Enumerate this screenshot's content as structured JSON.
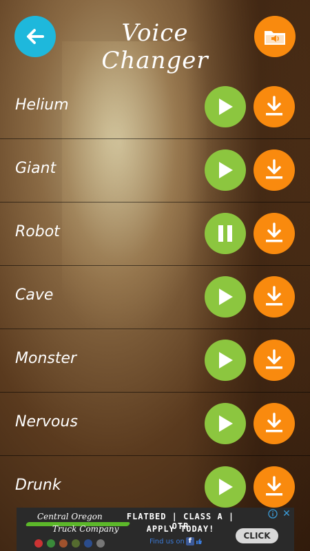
{
  "header": {
    "back_icon": "arrow-left-icon",
    "title": "Voice Changer",
    "folder_icon": "folder-sound-icon"
  },
  "effects": [
    {
      "label": "Helium",
      "state": "play"
    },
    {
      "label": "Giant",
      "state": "play"
    },
    {
      "label": "Robot",
      "state": "pause"
    },
    {
      "label": "Cave",
      "state": "play"
    },
    {
      "label": "Monster",
      "state": "play"
    },
    {
      "label": "Nervous",
      "state": "play"
    },
    {
      "label": "Drunk",
      "state": "play"
    }
  ],
  "ad": {
    "company_line1": "Central Oregon",
    "company_line2": "Truck Company",
    "line1": "FLATBED | CLASS A | OTR",
    "line2": "APPLY TODAY!",
    "find_us": "Find us on",
    "cta": "CLICK",
    "close": "✕"
  },
  "colors": {
    "back_button": "#1eb8dc",
    "accent_orange": "#f98a0e",
    "play_green": "#8cc63f"
  }
}
